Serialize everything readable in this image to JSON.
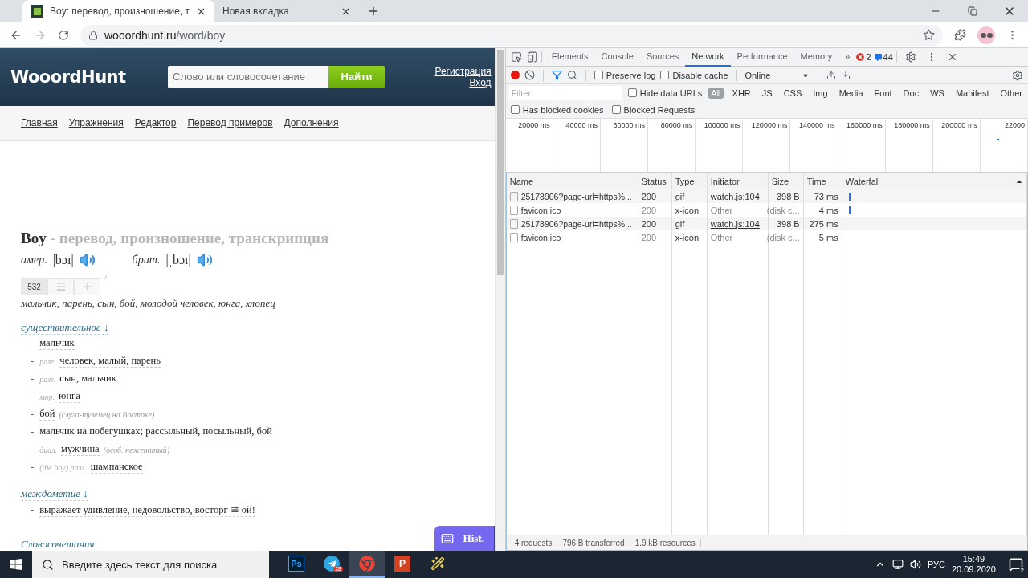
{
  "browser": {
    "tabs": [
      {
        "title": "Boy: перевод, произношение, т",
        "selected": true,
        "favicon": true
      },
      {
        "title": "Новая вкладка",
        "selected": false,
        "favicon": false
      }
    ],
    "url": {
      "host": "wooordhunt.ru",
      "path": "/word/boy"
    }
  },
  "page": {
    "logo": "WooordHunt",
    "search": {
      "placeholder": "Слово или словосочетание",
      "button": "Найти"
    },
    "auth_links": [
      "Регистрация",
      "Вход"
    ],
    "nav": [
      "Главная",
      "Упражнения",
      "Редактор",
      "Перевод примеров",
      "Дополнения"
    ],
    "entry": {
      "word": "Boy",
      "subtitle": "- перевод, произношение, транскрипция",
      "pronunciations": [
        {
          "label": "амер.",
          "transcription": "|bɔɪ|"
        },
        {
          "label": "брит.",
          "transcription": "|ˌbɔɪ|"
        }
      ],
      "counter": "532",
      "hint": "?",
      "summary": "мальчик, парень, сын, бой, молодой человек, юнга, хлопец",
      "sections": [
        {
          "heading": "существительное",
          "arrow": "↓",
          "items": [
            {
              "bullet": "-",
              "text": "мальчик"
            },
            {
              "bullet": "-",
              "label": "разг.",
              "text": "человек, малый, парень"
            },
            {
              "bullet": "-",
              "label": "разг.",
              "text": "сын, мальчик"
            },
            {
              "bullet": "-",
              "label": "мор.",
              "text": "юнга"
            },
            {
              "bullet": "-",
              "text": "бой",
              "note": "(слуга-туземец на Востоке)"
            },
            {
              "bullet": "-",
              "text": "мальчик на побегушках; рассыльный, посыльный, бой"
            },
            {
              "bullet": "-",
              "label": "диал.",
              "text": "мужчина",
              "note": "(особ. неженатый)"
            },
            {
              "bullet": "-",
              "label": "(the boy) разг.",
              "text": "шампанское"
            }
          ]
        },
        {
          "heading": "междометие",
          "arrow": "↓",
          "items": [
            {
              "bullet": "-",
              "text": "выражает удивление, недовольство, восторг ≅ ой!"
            }
          ]
        }
      ],
      "more_heading": "Словосочетания"
    },
    "hist_button": "Hist."
  },
  "devtools": {
    "tabs": [
      {
        "label": "Elements",
        "selected": false
      },
      {
        "label": "Console",
        "selected": false
      },
      {
        "label": "Sources",
        "selected": false
      },
      {
        "label": "Network",
        "selected": true
      },
      {
        "label": "Performance",
        "selected": false
      },
      {
        "label": "Memory",
        "selected": false
      }
    ],
    "more": "»",
    "errors": "2",
    "messages": "44",
    "preserve_log": {
      "label": "Preserve log",
      "checked": false
    },
    "disable_cache": {
      "label": "Disable cache",
      "checked": false
    },
    "throttle": "Online",
    "filter": {
      "placeholder": "Filter"
    },
    "hide_data_urls": {
      "label": "Hide data URLs",
      "checked": false
    },
    "types": [
      {
        "label": "All",
        "selected": true
      },
      {
        "label": "XHR",
        "selected": false
      },
      {
        "label": "JS",
        "selected": false
      },
      {
        "label": "CSS",
        "selected": false
      },
      {
        "label": "Img",
        "selected": false
      },
      {
        "label": "Media",
        "selected": false
      },
      {
        "label": "Font",
        "selected": false
      },
      {
        "label": "Doc",
        "selected": false
      },
      {
        "label": "WS",
        "selected": false
      },
      {
        "label": "Manifest",
        "selected": false
      },
      {
        "label": "Other",
        "selected": false
      }
    ],
    "has_blocked_cookies": {
      "label": "Has blocked cookies",
      "checked": false
    },
    "blocked_requests": {
      "label": "Blocked Requests",
      "checked": false
    },
    "timeline_ticks": [
      "20000 ms",
      "40000 ms",
      "60000 ms",
      "80000 ms",
      "100000 ms",
      "120000 ms",
      "140000 ms",
      "160000 ms",
      "180000 ms",
      "200000 ms",
      "22000"
    ],
    "columns": [
      "Name",
      "Status",
      "Type",
      "Initiator",
      "Size",
      "Time",
      "Waterfall"
    ],
    "rows": [
      {
        "name": "25178906?page-url=https%...",
        "status": "200",
        "type": "gif",
        "initiator": "watch.js:104",
        "size": "398 B",
        "time": "73 ms",
        "cached": false
      },
      {
        "name": "favicon.ico",
        "status": "200",
        "type": "x-icon",
        "initiator": "Other",
        "size": "(disk c...",
        "time": "4 ms",
        "cached": true
      },
      {
        "name": "25178906?page-url=https%...",
        "status": "200",
        "type": "gif",
        "initiator": "watch.js:104",
        "size": "398 B",
        "time": "275 ms",
        "cached": false
      },
      {
        "name": "favicon.ico",
        "status": "200",
        "type": "x-icon",
        "initiator": "Other",
        "size": "(disk c...",
        "time": "5 ms",
        "cached": true
      }
    ],
    "summary": [
      "4 requests",
      "796 B transferred",
      "1.9 kB resources"
    ]
  },
  "taskbar": {
    "search_placeholder": "Введите здесь текст для поиска",
    "apps": [
      {
        "kind": "photoshop",
        "label": "Ps",
        "selected": false
      },
      {
        "kind": "telegram",
        "badge": "28",
        "selected": false
      },
      {
        "kind": "chrome",
        "selected": true
      },
      {
        "kind": "powerpoint",
        "label": "P",
        "selected": false
      },
      {
        "kind": "wand",
        "selected": false
      }
    ],
    "language": "РУС",
    "time": "15:49",
    "date": "20.09.2020",
    "notifications": "2"
  }
}
